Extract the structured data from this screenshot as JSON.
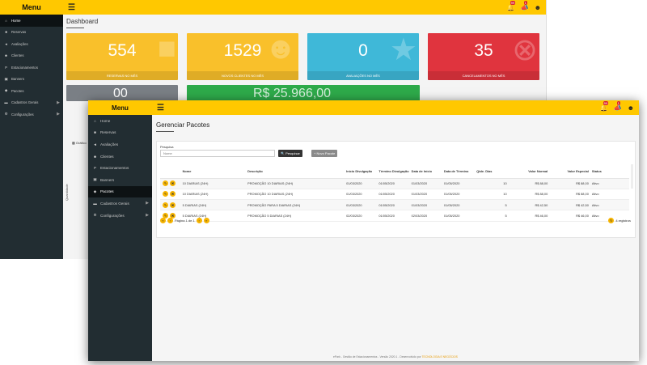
{
  "back": {
    "menu_title": "Menu",
    "nav": [
      {
        "label": "Home",
        "icon": "home-icon",
        "active": true
      },
      {
        "label": "Reservas",
        "icon": "car-icon"
      },
      {
        "label": "Avaliações",
        "icon": "megaphone-icon"
      },
      {
        "label": "Clientes",
        "icon": "users-icon"
      },
      {
        "label": "Estacionamentos",
        "icon": "parking-icon"
      },
      {
        "label": "Banners",
        "icon": "image-icon"
      },
      {
        "label": "Pacotes",
        "icon": "tags-icon"
      },
      {
        "label": "Cadastros Gerais",
        "icon": "folder-icon",
        "caret": true
      },
      {
        "label": "Configurações",
        "icon": "cogs-icon",
        "caret": true
      }
    ],
    "page_title": "Dashboard",
    "cards": [
      {
        "value": "554",
        "label": "RESERVAS NO MÊS",
        "color": "#f9c02b",
        "icon": "car-icon"
      },
      {
        "value": "1529",
        "label": "NOVOS CLIENTES NO MÊS",
        "color": "#f9c02b",
        "icon": "users-icon"
      },
      {
        "value": "0",
        "label": "AVALIAÇÕES NO MÊS",
        "color": "#3fb8d8",
        "icon": "star-icon"
      },
      {
        "value": "35",
        "label": "CANCELAMENTOS NO MÊS",
        "color": "#e0343e",
        "icon": "cancel-icon"
      }
    ],
    "second_row": {
      "value_a": "00",
      "value_b": "R$ 25.966,00",
      "color_a": "#7a7f85",
      "color_b": "#2eaa4a"
    },
    "side_label": "Gráfico",
    "axis_label": "Quantidade"
  },
  "front": {
    "menu_title": "Menu",
    "nav": [
      {
        "label": "Home",
        "icon": "home-icon"
      },
      {
        "label": "Reservas",
        "icon": "car-icon"
      },
      {
        "label": "Avaliações",
        "icon": "megaphone-icon"
      },
      {
        "label": "Clientes",
        "icon": "users-icon"
      },
      {
        "label": "Estacionamentos",
        "icon": "parking-icon"
      },
      {
        "label": "Banners",
        "icon": "image-icon"
      },
      {
        "label": "Pacotes",
        "icon": "tags-icon",
        "active": true
      },
      {
        "label": "Cadastros Gerais",
        "icon": "folder-icon",
        "caret": true
      },
      {
        "label": "Configurações",
        "icon": "cogs-icon",
        "caret": true
      }
    ],
    "page_title": "Gerenciar Pacotes",
    "search_label": "Pesquisa",
    "search_placeholder": "Nome",
    "btn_search": "Pesquisar",
    "btn_new": "Novo Pacote",
    "columns": [
      "Nome",
      "Descrição",
      "Início Divulgação",
      "Término Divulgação",
      "Data de Início",
      "Data de Término",
      "Qtde. Dias",
      "Valor Normal",
      "Valor Especial",
      "Status"
    ],
    "rows": [
      [
        "10 DIARIAS (24H)",
        "PROMOÇÃO 10 DIARIAS (24H)",
        "01/03/2020",
        "01/05/2020",
        "01/03/2020",
        "01/05/2020",
        "10",
        "R$ 88,00",
        "R$ 88,00",
        "Ativo"
      ],
      [
        "10 DIARIAS (24H)",
        "PROMOÇÃO 10 DIARIAS (24H)",
        "01/03/2020",
        "01/05/2020",
        "01/03/2020",
        "01/05/2020",
        "10",
        "R$ 88,00",
        "R$ 88,00",
        "Ativo"
      ],
      [
        "5 DIARIAS (24H)",
        "PROMOÇÃO PARA 5 DIARIAS (24H)",
        "01/03/2020",
        "01/05/2020",
        "01/03/2020",
        "01/05/2020",
        "5",
        "R$ 42,50",
        "R$ 42,50",
        "Ativo"
      ],
      [
        "5 DIARIAS (24H)",
        "PROMOÇÃO 5 DIARIAS (24H)",
        "02/03/2020",
        "01/05/2020",
        "02/03/2020",
        "01/05/2020",
        "5",
        "R$ 46,00",
        "R$ 46,00",
        "Ativo"
      ]
    ],
    "pager_text": "Página 1 de 1",
    "records": "4 registros",
    "footer_text": "ePark - Gestão de Estacionamentos - Versão 2020.1 - Desenvolvido por ",
    "footer_highlight": "TECNOLOGIA E NEGÓCIOS"
  },
  "colors": {
    "accent": "#ffc800",
    "sidebar": "#222d32",
    "badge": "#d9232d"
  }
}
